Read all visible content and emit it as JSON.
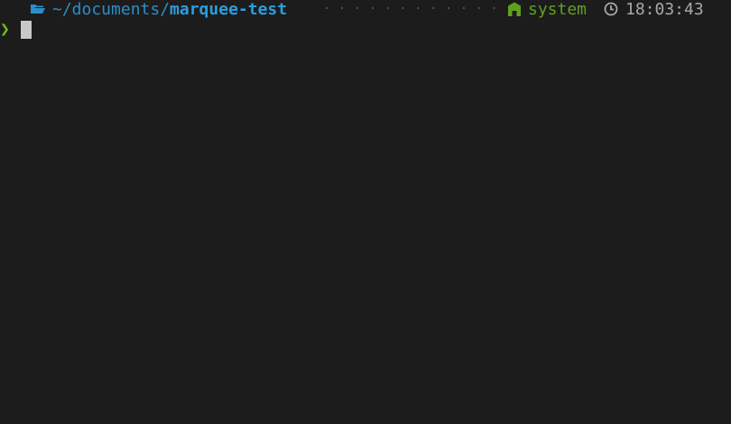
{
  "prompt": {
    "icons": {
      "folder": "folder-open-icon",
      "environment": "node-icon",
      "clock": "clock-icon"
    },
    "path_prefix": "~/documents/",
    "path_current": "marquee-test",
    "separator": "· · · · · · · · · · · · · · · ·",
    "environment": "system",
    "time": "18:03:43",
    "prompt_symbol": "❯"
  },
  "colors": {
    "background": "#1c1c1c",
    "path": "#2a8fc7",
    "environment": "#5fa020",
    "prompt_symbol": "#6fbf1c",
    "time": "#a8a8a8",
    "cursor": "#c8c8c8"
  }
}
